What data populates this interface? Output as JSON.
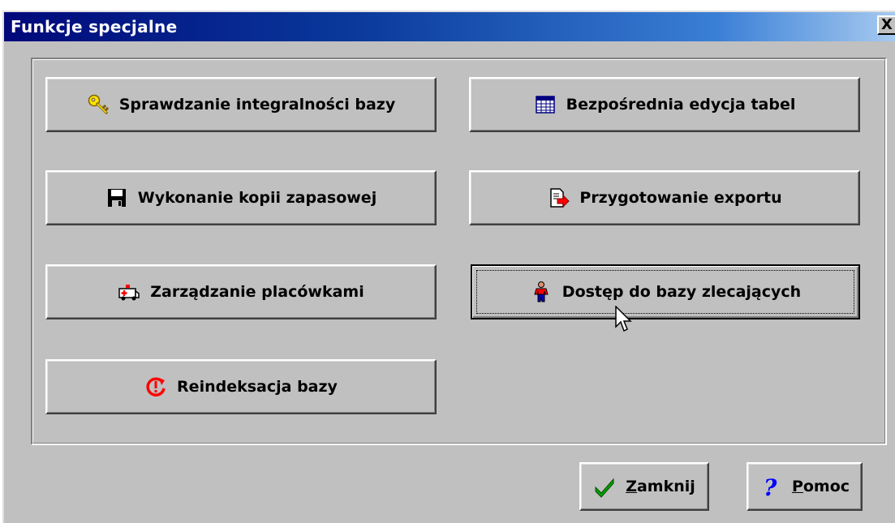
{
  "window": {
    "title": "Funkcje specjalne",
    "close_label": "X"
  },
  "buttons": {
    "integrity": {
      "label": "Sprawdzanie integralności bazy",
      "icon": "key-icon"
    },
    "direct_edit": {
      "label": "Bezpośrednia edycja tabel",
      "icon": "table-grid-icon"
    },
    "backup": {
      "label": "Wykonanie kopii zapasowej",
      "icon": "floppy-disk-icon"
    },
    "export": {
      "label": "Przygotowanie exportu",
      "icon": "export-arrow-icon"
    },
    "facilities": {
      "label": "Zarządzanie placówkami",
      "icon": "ambulance-icon"
    },
    "clients": {
      "label": "Dostęp do bazy zlecających",
      "icon": "person-icon"
    },
    "reindex": {
      "label": "Reindeksacja bazy",
      "icon": "reindex-refresh-icon"
    }
  },
  "footer": {
    "close": {
      "accel": "Z",
      "rest": "amknij",
      "icon": "checkmark-icon"
    },
    "help": {
      "accel": "P",
      "rest": "omoc",
      "icon": "question-mark-icon"
    }
  },
  "colors": {
    "title_gradient_start": "#00087a",
    "title_gradient_end": "#a6caf0",
    "face": "#c0c0c0"
  }
}
